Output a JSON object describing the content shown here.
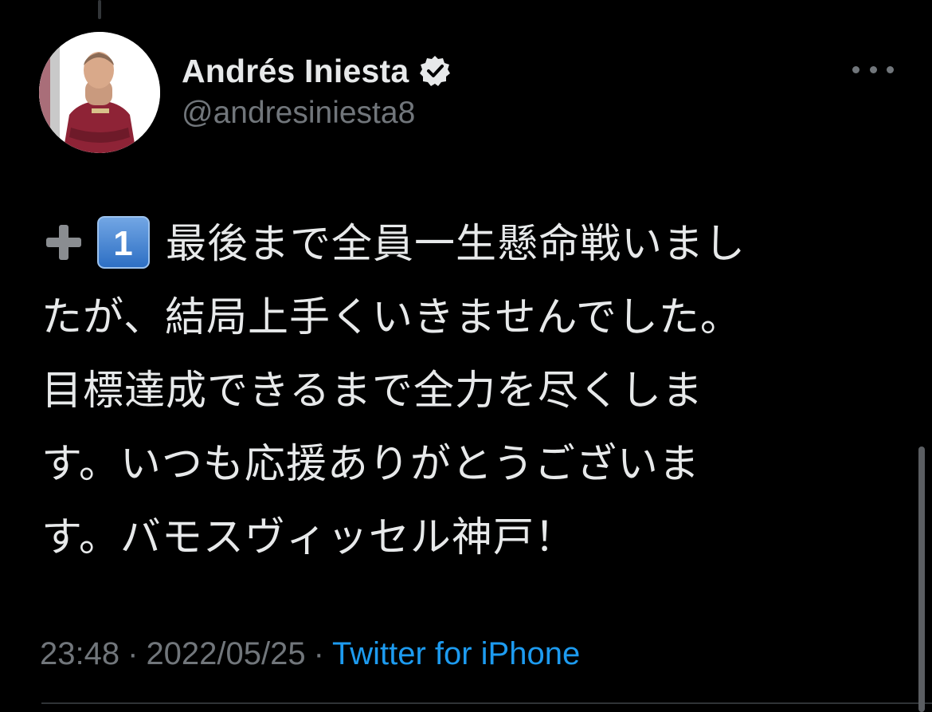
{
  "author": {
    "display_name": "Andrés Iniesta",
    "handle": "@andresiniesta8",
    "verified": true,
    "avatar_icon": "profile-photo"
  },
  "tweet": {
    "emoji": {
      "plus": "➕",
      "keycap": "1"
    },
    "lines": [
      "最後まで全員一生懸命戦いまし",
      "たが、結局上手くいきませんでした。",
      "目標達成できるまで全力を尽くしま",
      "す。いつも応援ありがとうございま",
      "す。バモスヴィッセル神戸！"
    ]
  },
  "meta": {
    "time": "23:48",
    "separator": "·",
    "date": "2022/05/25",
    "source": "Twitter for iPhone"
  },
  "colors": {
    "background": "#000000",
    "text_primary": "#e7e9ea",
    "text_secondary": "#71767b",
    "link": "#1d9bf0",
    "jersey": "#8e2336"
  }
}
